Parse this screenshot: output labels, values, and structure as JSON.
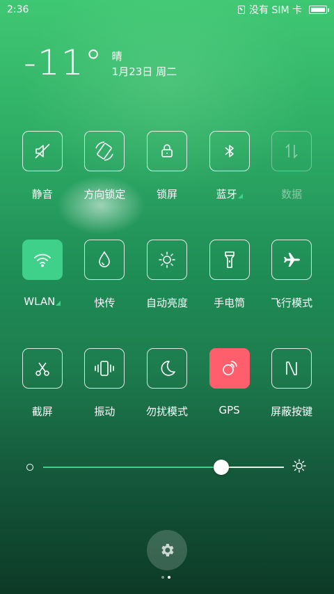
{
  "status_bar": {
    "time": "2:36",
    "sim_text": "没有 SIM 卡",
    "icons": [
      "sim-icon",
      "battery-icon"
    ]
  },
  "weather": {
    "temperature": "-11°",
    "condition": "晴",
    "date": "1月23日 周二"
  },
  "tiles": [
    {
      "label": "静音",
      "icon": "mute-icon",
      "state": "off"
    },
    {
      "label": "方向锁定",
      "icon": "rotation-lock-icon",
      "state": "off"
    },
    {
      "label": "锁屏",
      "icon": "lock-icon",
      "state": "off"
    },
    {
      "label": "蓝牙",
      "icon": "bluetooth-icon",
      "state": "off",
      "has_more": true
    },
    {
      "label": "数据",
      "icon": "data-icon",
      "state": "disabled"
    },
    {
      "label": "WLAN",
      "icon": "wifi-icon",
      "state": "on",
      "has_more": true
    },
    {
      "label": "快传",
      "icon": "quick-transfer-icon",
      "state": "off"
    },
    {
      "label": "自动亮度",
      "icon": "auto-brightness-icon",
      "state": "off"
    },
    {
      "label": "手电筒",
      "icon": "flashlight-icon",
      "state": "off"
    },
    {
      "label": "飞行模式",
      "icon": "airplane-icon",
      "state": "off"
    },
    {
      "label": "截屏",
      "icon": "screenshot-icon",
      "state": "off"
    },
    {
      "label": "振动",
      "icon": "vibrate-icon",
      "state": "off"
    },
    {
      "label": "勿扰模式",
      "icon": "moon-icon",
      "state": "off"
    },
    {
      "label": "GPS",
      "icon": "gps-icon",
      "state": "on"
    },
    {
      "label": "屏蔽按键",
      "icon": "block-keys-icon",
      "state": "off"
    }
  ],
  "brightness": {
    "level": 0.74,
    "icons": [
      "brightness-low-icon",
      "brightness-high-icon"
    ]
  },
  "settings": {
    "icon": "gear-icon"
  },
  "pager": {
    "pages": 2,
    "current": 2
  },
  "colors": {
    "accent": "#3fd18a",
    "gps_active": "#ff5f6d"
  }
}
